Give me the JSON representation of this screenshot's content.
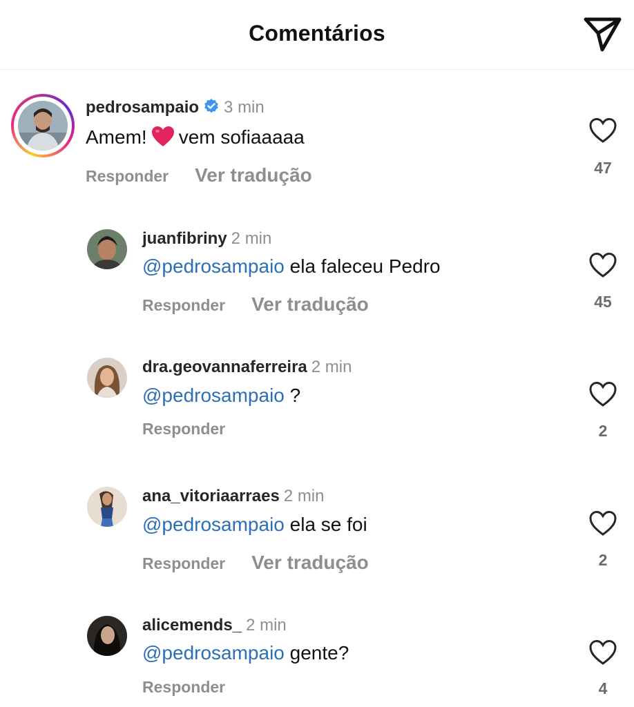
{
  "header": {
    "title": "Comentários",
    "share_icon": "paper-plane-icon"
  },
  "comments": [
    {
      "username": "pedrosampaio",
      "verified": true,
      "time": "3 min",
      "text_before": "Amem!",
      "emoji": "red-heart-emoji",
      "text_after": "vem sofiaaaaa",
      "reply_label": "Responder",
      "translate_label": "Ver tradução",
      "likes": "47"
    },
    {
      "username": "juanfibriny",
      "time": "2 min",
      "mention": "@pedrosampaio",
      "text": " ela faleceu Pedro",
      "reply_label": "Responder",
      "translate_label": "Ver tradução",
      "likes": "45"
    },
    {
      "username": "dra.geovannaferreira",
      "time": "2 min",
      "mention": "@pedrosampaio",
      "text": " ?",
      "reply_label": "Responder",
      "likes": "2"
    },
    {
      "username": "ana_vitoriaarraes",
      "time": "2 min",
      "mention": "@pedrosampaio",
      "text": " ela se foi",
      "reply_label": "Responder",
      "translate_label": "Ver tradução",
      "likes": "2"
    },
    {
      "username": "alicemends_",
      "time": "2 min",
      "mention": "@pedrosampaio",
      "text": " gente?",
      "reply_label": "Responder",
      "likes": "4"
    }
  ],
  "colors": {
    "mention": "#2a6fb8",
    "secondary_text": "#8e8e8e",
    "verified_badge": "#3897f0",
    "emoji_heart": "#e0245e"
  }
}
